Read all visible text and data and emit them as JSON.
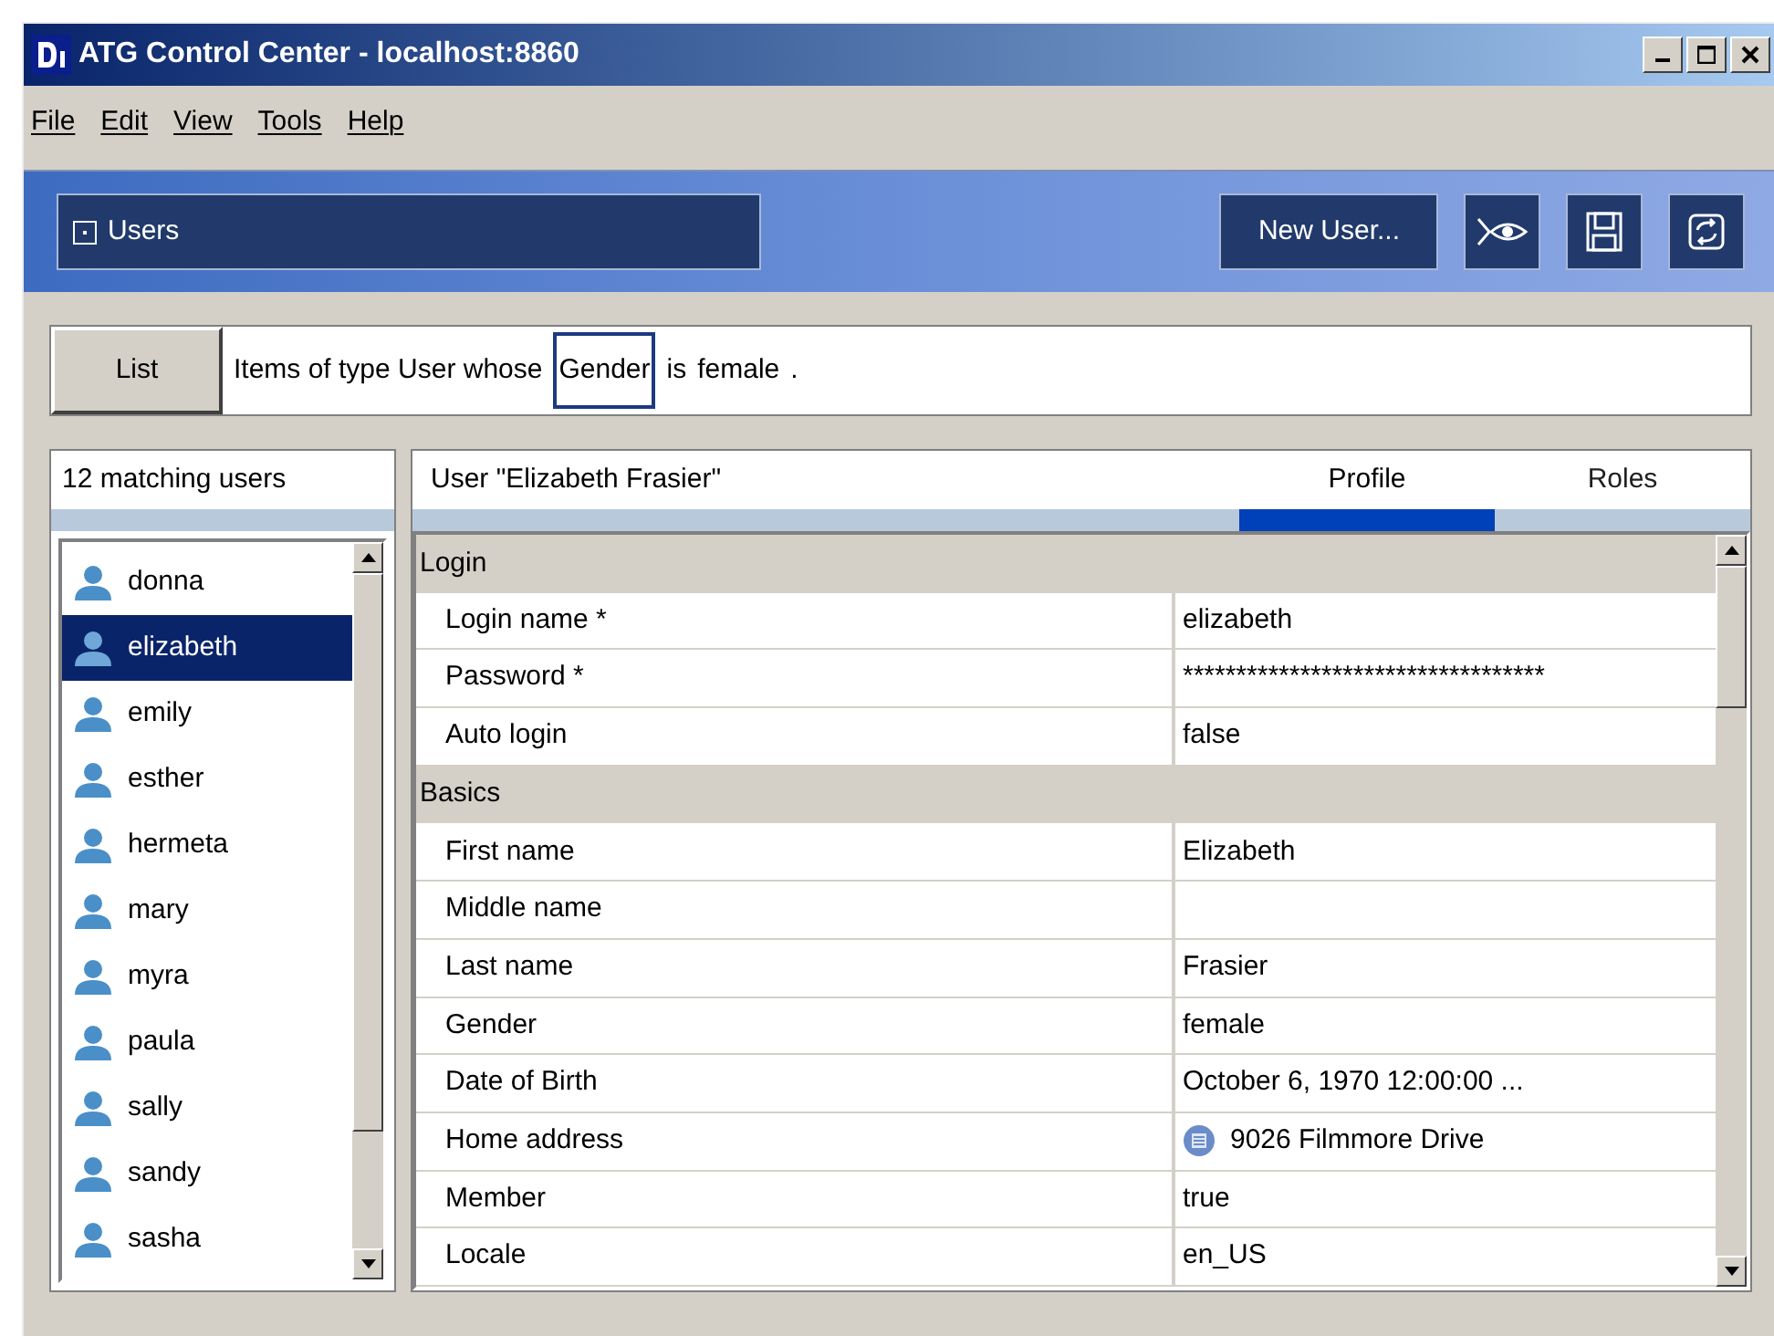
{
  "window": {
    "title": "ATG Control Center - localhost:8860"
  },
  "menu": [
    "File",
    "Edit",
    "View",
    "Tools",
    "Help"
  ],
  "toolbar": {
    "view_label": "Users",
    "new_button": "New User..."
  },
  "query": {
    "button": "List",
    "parts": [
      {
        "text": "Items of type User whose",
        "kind": "plain"
      },
      {
        "text": "Gender",
        "kind": "field"
      },
      {
        "text": "is",
        "kind": "plain"
      },
      {
        "text": "female",
        "kind": "plain"
      },
      {
        "text": ".",
        "kind": "plain"
      }
    ]
  },
  "users": {
    "header": "12 matching users",
    "items": [
      {
        "name": "donna",
        "selected": false
      },
      {
        "name": "elizabeth",
        "selected": true
      },
      {
        "name": "emily",
        "selected": false
      },
      {
        "name": "esther",
        "selected": false
      },
      {
        "name": "hermeta",
        "selected": false
      },
      {
        "name": "mary",
        "selected": false
      },
      {
        "name": "myra",
        "selected": false
      },
      {
        "name": "paula",
        "selected": false
      },
      {
        "name": "sally",
        "selected": false
      },
      {
        "name": "sandy",
        "selected": false
      },
      {
        "name": "sasha",
        "selected": false
      }
    ]
  },
  "detail": {
    "title": "User \"Elizabeth Frasier\"",
    "tabs": [
      {
        "label": "Profile",
        "selected": true
      },
      {
        "label": "Roles",
        "selected": false
      }
    ],
    "rows": [
      {
        "kind": "section",
        "label": "Login"
      },
      {
        "kind": "property",
        "label": "Login name *",
        "value": "elizabeth"
      },
      {
        "kind": "property",
        "label": "Password *",
        "value": "**********************************"
      },
      {
        "kind": "property",
        "label": "Auto login",
        "value": "false"
      },
      {
        "kind": "section",
        "label": "Basics"
      },
      {
        "kind": "property",
        "label": "First name",
        "value": "Elizabeth"
      },
      {
        "kind": "property",
        "label": "Middle name"
      },
      {
        "kind": "property",
        "label": "Last name",
        "value": "Frasier"
      },
      {
        "kind": "property",
        "label": "Gender",
        "value": "female"
      },
      {
        "kind": "property",
        "label": "Date of Birth",
        "value": "October 6, 1970 12:00:00 ..."
      },
      {
        "kind": "link",
        "label": "Home address",
        "value": "9026 Filmmore Drive"
      },
      {
        "kind": "property",
        "label": "Member",
        "value": "true"
      },
      {
        "kind": "property",
        "label": "Locale",
        "value": "en_US"
      }
    ]
  }
}
